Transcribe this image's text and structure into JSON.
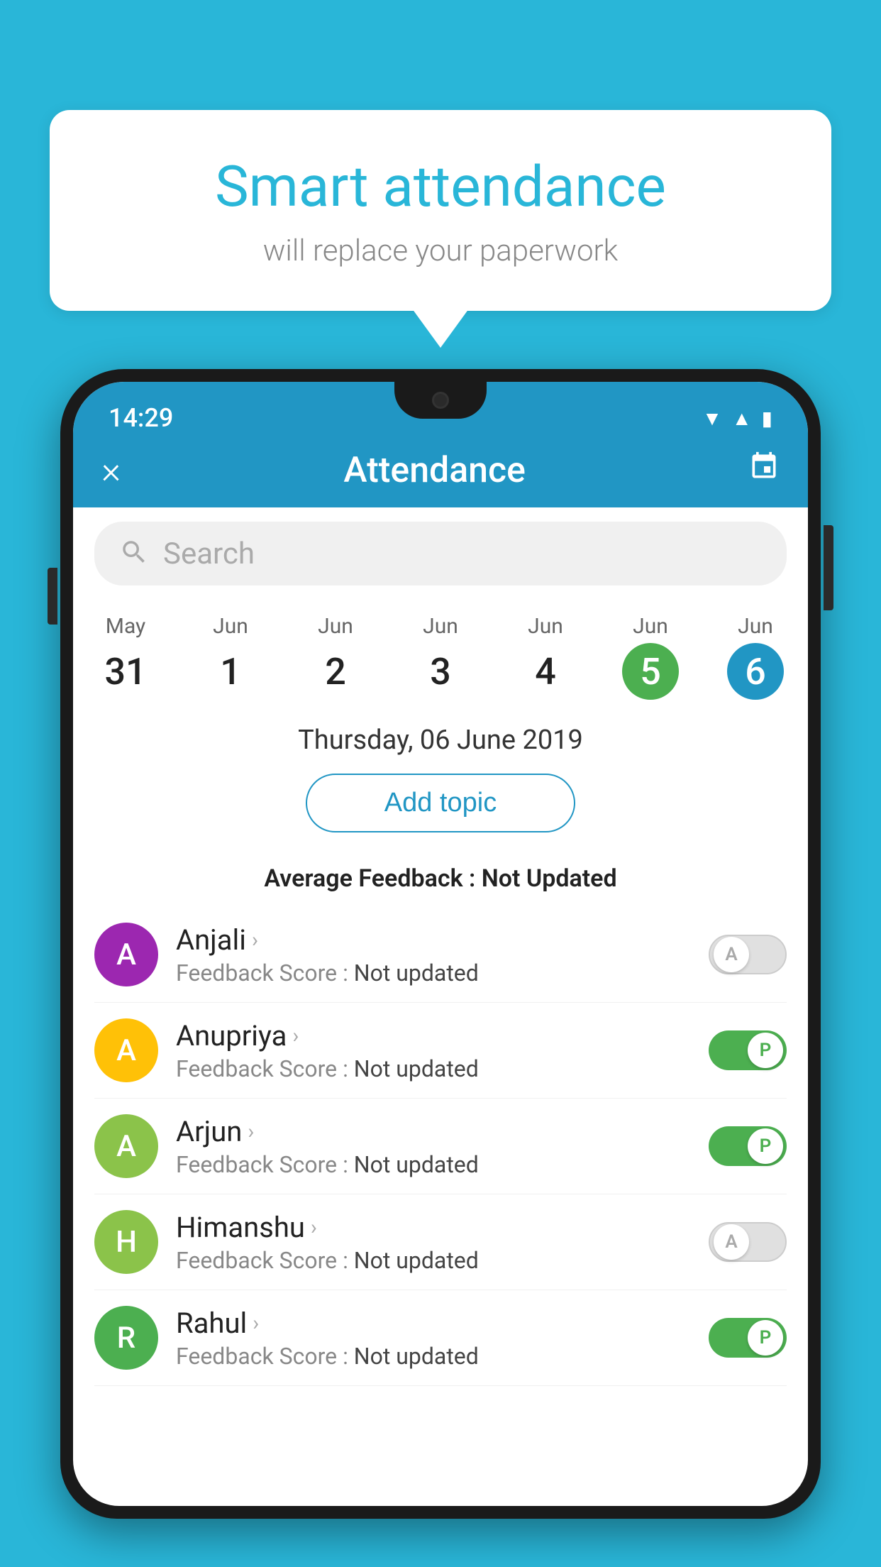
{
  "background_color": "#29b6d8",
  "bubble": {
    "title": "Smart attendance",
    "subtitle": "will replace your paperwork"
  },
  "status_bar": {
    "time": "14:29",
    "wifi": "▼",
    "signal": "▲",
    "battery": "▮"
  },
  "header": {
    "title": "Attendance",
    "close_label": "×",
    "calendar_icon": "📅"
  },
  "search": {
    "placeholder": "Search"
  },
  "calendar": {
    "days": [
      {
        "month": "May",
        "date": "31",
        "style": "normal"
      },
      {
        "month": "Jun",
        "date": "1",
        "style": "normal"
      },
      {
        "month": "Jun",
        "date": "2",
        "style": "normal"
      },
      {
        "month": "Jun",
        "date": "3",
        "style": "normal"
      },
      {
        "month": "Jun",
        "date": "4",
        "style": "normal"
      },
      {
        "month": "Jun",
        "date": "5",
        "style": "today"
      },
      {
        "month": "Jun",
        "date": "6",
        "style": "selected"
      }
    ]
  },
  "selected_date": "Thursday, 06 June 2019",
  "add_topic_label": "Add topic",
  "avg_feedback_label": "Average Feedback : ",
  "avg_feedback_value": "Not Updated",
  "students": [
    {
      "name": "Anjali",
      "initial": "A",
      "avatar_color": "#9c27b0",
      "feedback": "Feedback Score : ",
      "feedback_value": "Not updated",
      "status": "absent"
    },
    {
      "name": "Anupriya",
      "initial": "A",
      "avatar_color": "#ffc107",
      "feedback": "Feedback Score : ",
      "feedback_value": "Not updated",
      "status": "present"
    },
    {
      "name": "Arjun",
      "initial": "A",
      "avatar_color": "#8bc34a",
      "feedback": "Feedback Score : ",
      "feedback_value": "Not updated",
      "status": "present"
    },
    {
      "name": "Himanshu",
      "initial": "H",
      "avatar_color": "#8bc34a",
      "feedback": "Feedback Score : ",
      "feedback_value": "Not updated",
      "status": "absent"
    },
    {
      "name": "Rahul",
      "initial": "R",
      "avatar_color": "#4caf50",
      "feedback": "Feedback Score : ",
      "feedback_value": "Not updated",
      "status": "present"
    }
  ]
}
